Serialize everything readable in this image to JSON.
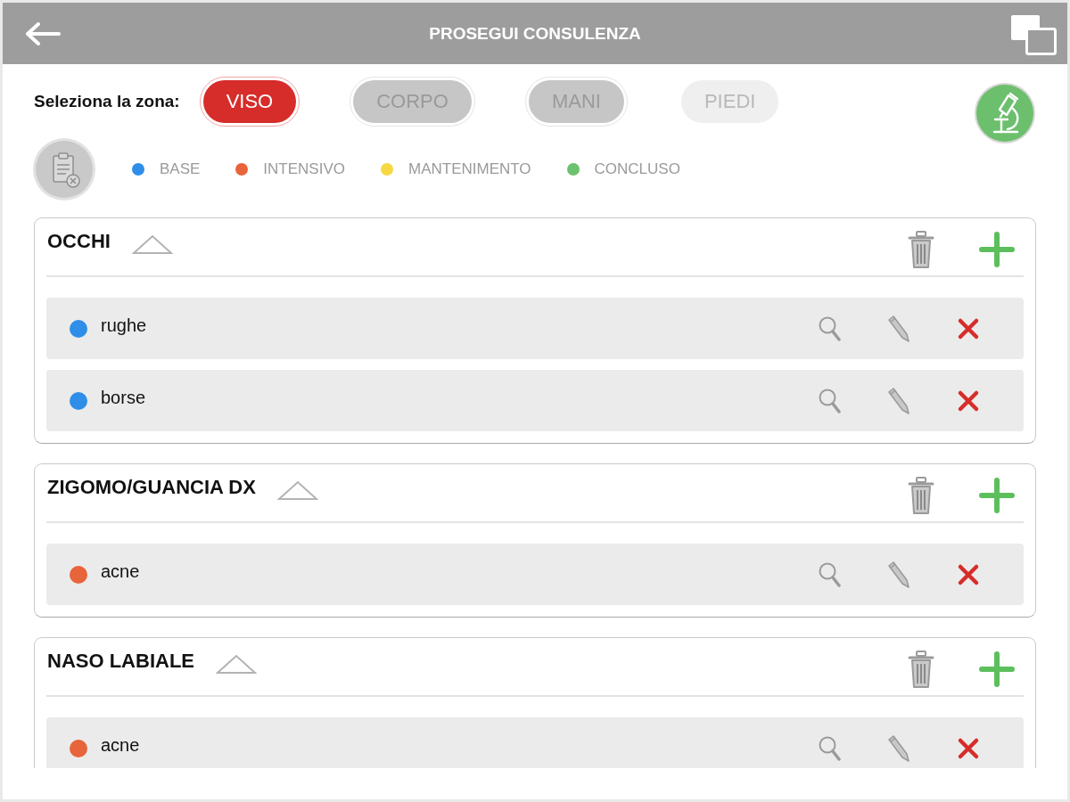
{
  "header": {
    "title": "PROSEGUI CONSULENZA"
  },
  "zone_selector": {
    "label": "Seleziona la zona:",
    "zones": [
      {
        "label": "VISO",
        "selected": true,
        "disabled": false
      },
      {
        "label": "CORPO",
        "selected": false,
        "disabled": false
      },
      {
        "label": "MANI",
        "selected": false,
        "disabled": false
      },
      {
        "label": "PIEDI",
        "selected": false,
        "disabled": true
      }
    ]
  },
  "legend": [
    {
      "label": "BASE",
      "color": "#2e8ee8"
    },
    {
      "label": "INTENSIVO",
      "color": "#e8643a"
    },
    {
      "label": "MANTENIMENTO",
      "color": "#f7d842"
    },
    {
      "label": "CONCLUSO",
      "color": "#6cc26e"
    }
  ],
  "sections": [
    {
      "title": "OCCHI",
      "expanded": true,
      "items": [
        {
          "label": "rughe",
          "color": "#2e8ee8"
        },
        {
          "label": "borse",
          "color": "#2e8ee8"
        }
      ]
    },
    {
      "title": "ZIGOMO/GUANCIA DX",
      "expanded": true,
      "items": [
        {
          "label": "acne",
          "color": "#e8643a"
        }
      ]
    },
    {
      "title": "NASO LABIALE",
      "expanded": true,
      "items": [
        {
          "label": "acne",
          "color": "#e8643a"
        }
      ]
    }
  ]
}
